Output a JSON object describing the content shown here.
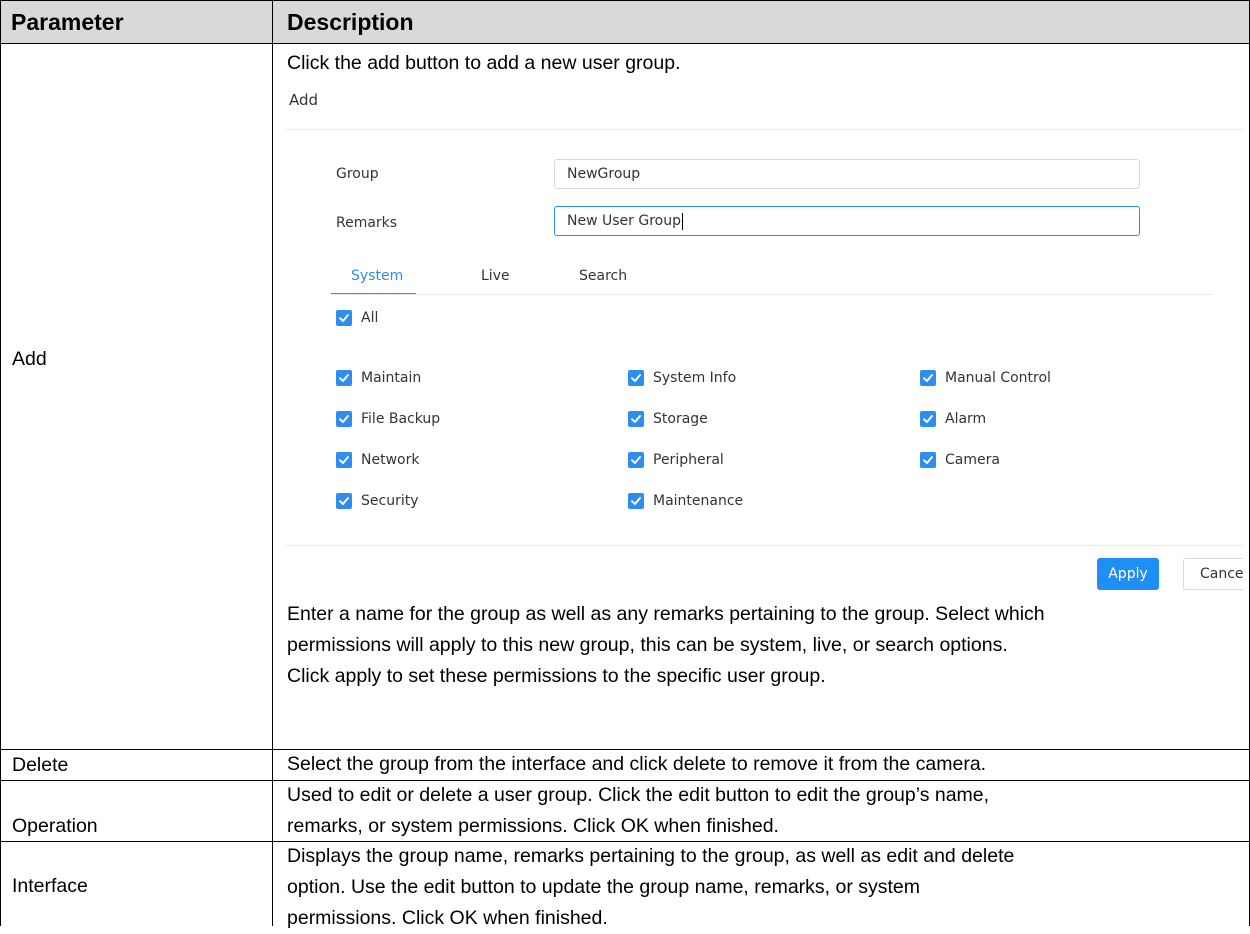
{
  "header": {
    "param": "Parameter",
    "desc": "Description"
  },
  "rows": {
    "add": {
      "param": "Add",
      "intro": "Click the add button to add a new user group.",
      "outro": [
        "Enter a name for the group as well as any remarks pertaining to the group. Select which",
        "permissions will apply to this new group, this can be system, live, or search options.",
        "Click apply to set these permissions to the specific user group."
      ]
    },
    "delete": {
      "param": "Delete",
      "lines": [
        "Select the group from the interface and click delete to remove it from the camera."
      ]
    },
    "operation": {
      "param": "Operation",
      "lines": [
        "Used to edit or delete a user group. Click the edit button to edit the group’s name,",
        "remarks, or system permissions. Click OK when finished."
      ]
    },
    "interface": {
      "param": "Interface",
      "lines": [
        "Displays the group name, remarks pertaining to the group, as well as edit and delete",
        "option. Use the edit button to update the group name, remarks, or system",
        "permissions. Click OK when finished."
      ]
    }
  },
  "ui": {
    "title": "Add",
    "group_label": "Group",
    "group_value": "NewGroup",
    "remarks_label": "Remarks",
    "remarks_value": "New User Group",
    "tabs": [
      "System",
      "Live",
      "Search"
    ],
    "active_tab": "System",
    "all_label": "All",
    "permissions": [
      [
        "Maintain",
        "System Info",
        "Manual Control"
      ],
      [
        "File Backup",
        "Storage",
        "Alarm"
      ],
      [
        "Network",
        "Peripheral",
        "Camera"
      ],
      [
        "Security",
        "Maintenance",
        ""
      ]
    ],
    "apply_label": "Apply",
    "cancel_label": "Cance",
    "accent_color": "#2f8cf0",
    "checkbox_icon": "checkmark-icon"
  }
}
